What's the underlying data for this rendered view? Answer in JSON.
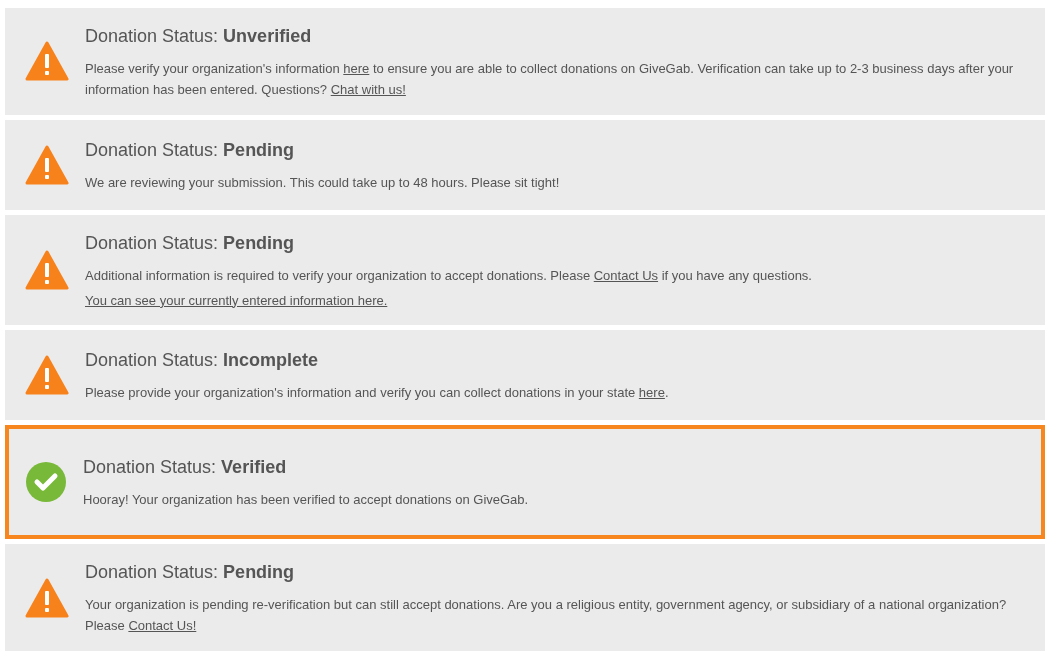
{
  "cards": [
    {
      "kind": "warning",
      "highlighted": false,
      "label": "Donation Status:",
      "status": "Unverified",
      "lines": [
        [
          {
            "text": "Please verify your organization's information ",
            "link": false
          },
          {
            "text": "here",
            "link": true
          },
          {
            "text": " to ensure you are able to collect donations on GiveGab. Verification can take up to 2-3 business days after your information has been entered. Questions? ",
            "link": false
          },
          {
            "text": "Chat with us!",
            "link": true
          }
        ]
      ]
    },
    {
      "kind": "warning",
      "highlighted": false,
      "label": "Donation Status:",
      "status": "Pending",
      "lines": [
        [
          {
            "text": "We are reviewing your submission. This could take up to 48 hours. Please sit tight!",
            "link": false
          }
        ]
      ]
    },
    {
      "kind": "warning",
      "highlighted": false,
      "label": "Donation Status:",
      "status": "Pending",
      "lines": [
        [
          {
            "text": "Additional information is required to verify your organization to accept donations. Please ",
            "link": false
          },
          {
            "text": "Contact Us",
            "link": true
          },
          {
            "text": " if you have any questions.",
            "link": false
          }
        ],
        [
          {
            "text": "You can see your currently entered information here.",
            "link": true
          }
        ]
      ]
    },
    {
      "kind": "warning",
      "highlighted": false,
      "label": "Donation Status:",
      "status": "Incomplete",
      "lines": [
        [
          {
            "text": "Please provide your organization's information and verify you can collect donations in your state ",
            "link": false
          },
          {
            "text": "here",
            "link": true
          },
          {
            "text": ".",
            "link": false
          }
        ]
      ]
    },
    {
      "kind": "success",
      "highlighted": true,
      "label": "Donation Status:",
      "status": "Verified",
      "lines": [
        [
          {
            "text": "Hooray! Your organization has been verified to accept donations on GiveGab.",
            "link": false
          }
        ]
      ]
    },
    {
      "kind": "warning",
      "highlighted": false,
      "label": "Donation Status:",
      "status": "Pending",
      "lines": [
        [
          {
            "text": "Your organization is pending re-verification but can still accept donations. Are you a religious entity, government agency, or subsidiary of a national organization? Please ",
            "link": false
          },
          {
            "text": "Contact Us!",
            "link": true
          }
        ]
      ]
    }
  ]
}
